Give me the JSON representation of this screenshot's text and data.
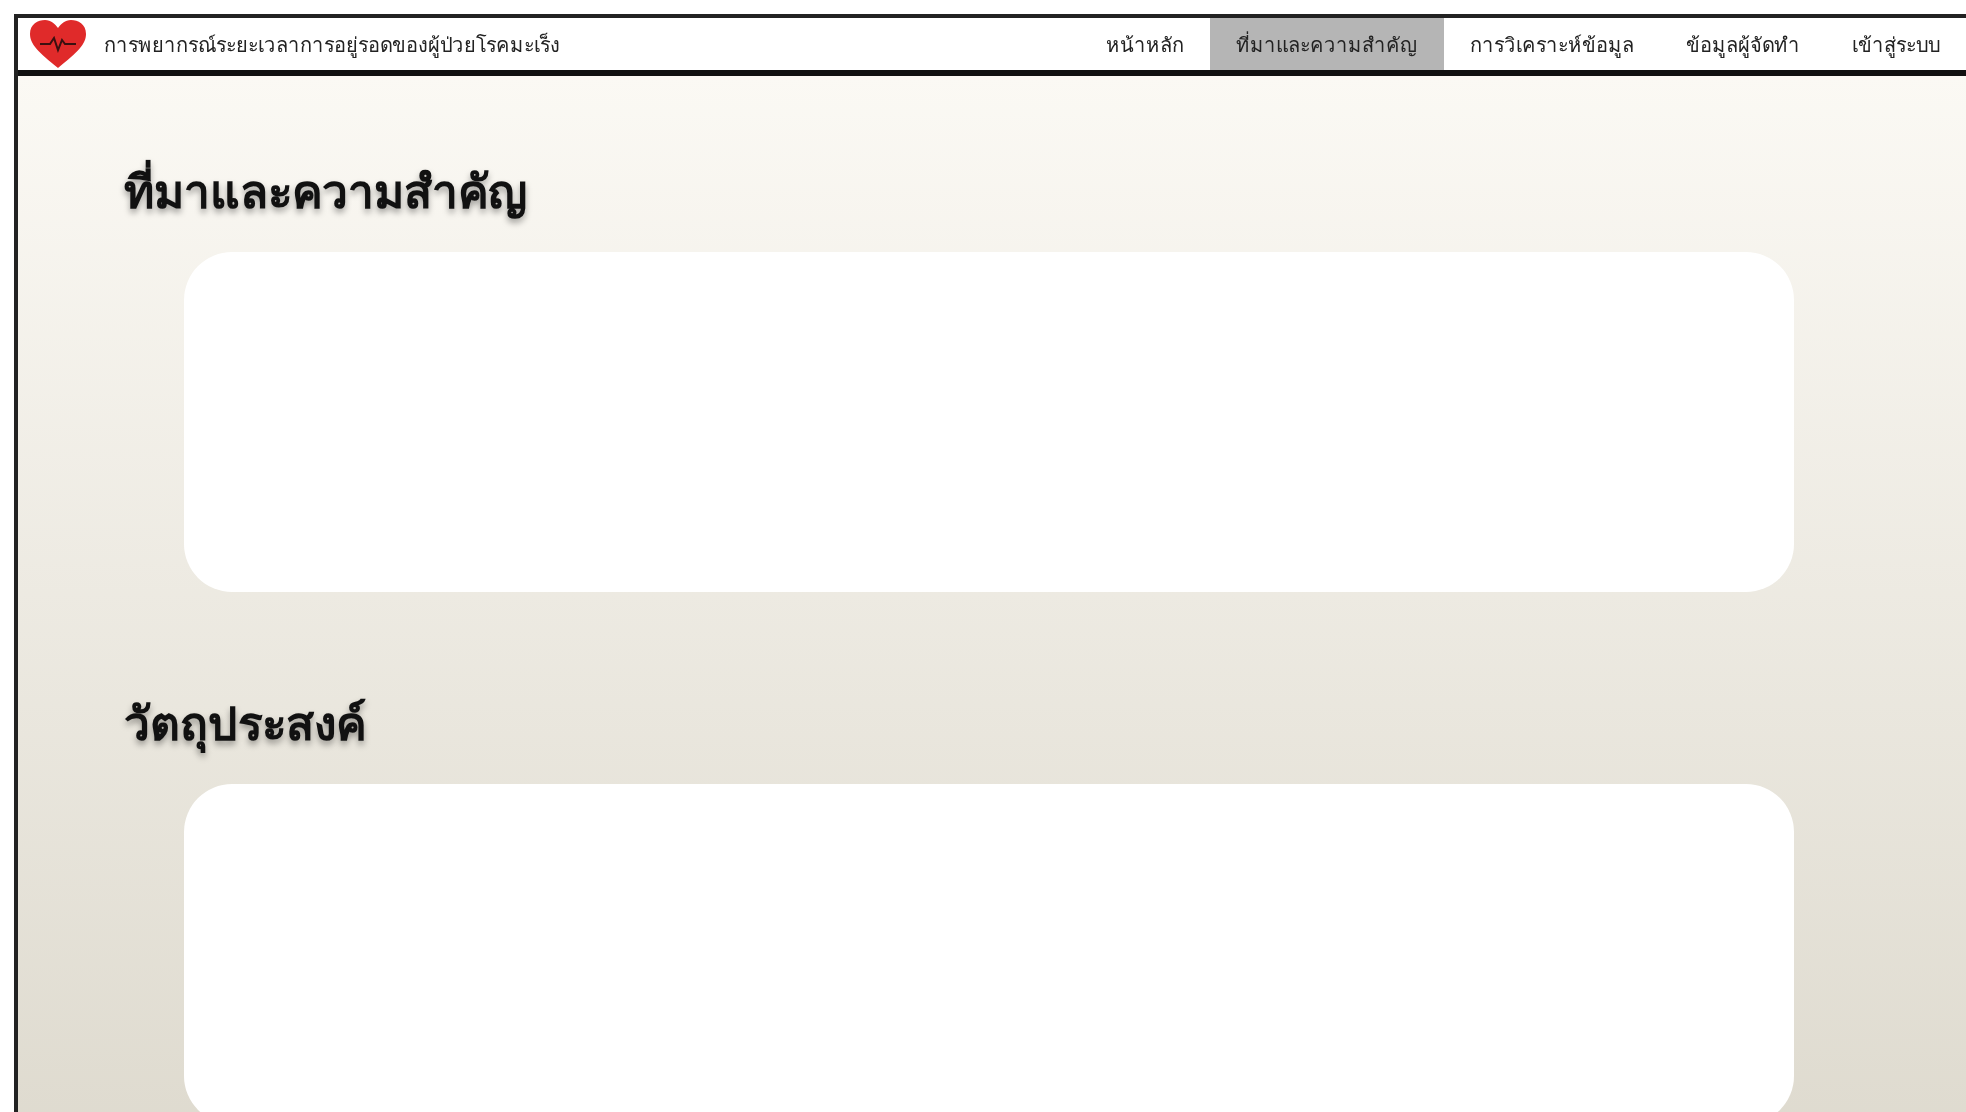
{
  "header": {
    "title": "การพยากรณ์ระยะเวลาการอยู่รอดของผู้ป่วยโรคมะเร็ง"
  },
  "nav": [
    {
      "label": "หน้าหลัก",
      "selected": false
    },
    {
      "label": "ที่มาและความสำคัญ",
      "selected": true
    },
    {
      "label": "การวิเคราะห์ข้อมูล",
      "selected": false
    },
    {
      "label": "ข้อมูลผู้จัดทำ",
      "selected": false
    },
    {
      "label": "เข้าสู่ระบบ",
      "selected": false
    }
  ],
  "sections": [
    {
      "heading": "ที่มาและความสำคัญ"
    },
    {
      "heading": "วัตถุประสงค์"
    }
  ]
}
